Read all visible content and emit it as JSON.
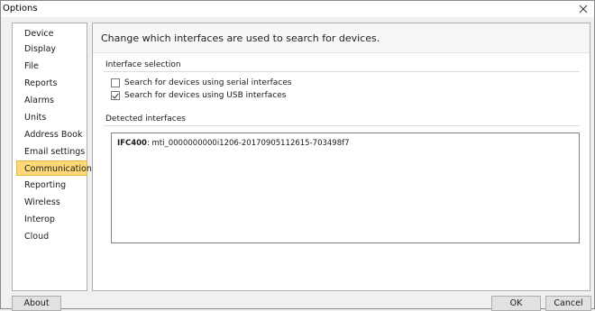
{
  "window": {
    "title": "Options"
  },
  "sidebar": {
    "items": [
      {
        "label": "Device"
      },
      {
        "label": "Display"
      },
      {
        "label": "File"
      },
      {
        "label": "Reports"
      },
      {
        "label": "Alarms"
      },
      {
        "label": "Units"
      },
      {
        "label": "Address Book"
      },
      {
        "label": "Email settings"
      },
      {
        "label": "Communication"
      },
      {
        "label": "Reporting"
      },
      {
        "label": "Wireless"
      },
      {
        "label": "Interop"
      },
      {
        "label": "Cloud"
      }
    ],
    "selected": "Communication",
    "selected_color": "#ffd877"
  },
  "content": {
    "header": "Change which interfaces are used to search for devices.",
    "interface_selection": {
      "label": "Interface selection",
      "options": [
        {
          "label": "Search for devices using serial interfaces",
          "checked": false
        },
        {
          "label": "Search for devices using USB interfaces",
          "checked": true
        }
      ]
    },
    "detected_interfaces": {
      "label": "Detected interfaces",
      "items": [
        {
          "name": "IFC400",
          "id": ": mti_0000000000i1206-20170905112615-703498f7"
        }
      ]
    }
  },
  "buttons": {
    "about": "About",
    "ok": "OK",
    "cancel": "Cancel"
  }
}
